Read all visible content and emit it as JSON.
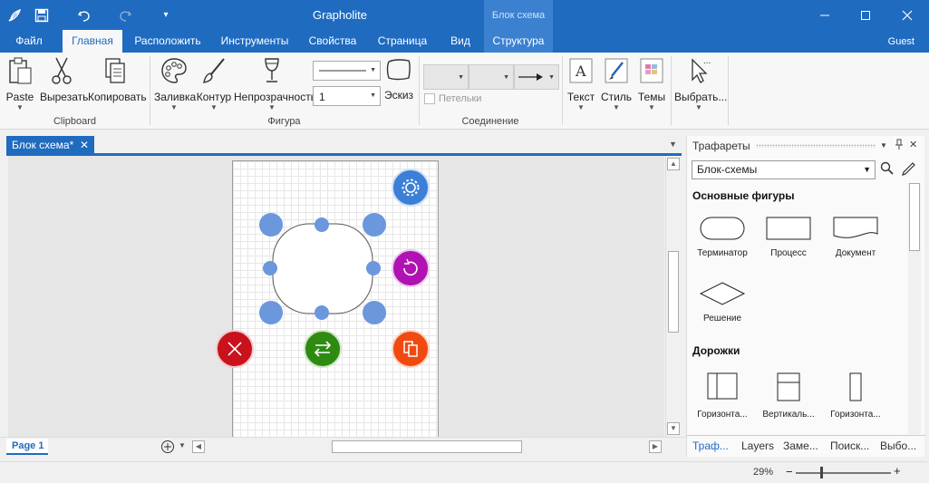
{
  "app": {
    "title": "Grapholite",
    "context_tab_header": "Блок схема",
    "user": "Guest"
  },
  "menu_tabs": [
    {
      "label": "Файл"
    },
    {
      "label": "Главная"
    },
    {
      "label": "Расположить"
    },
    {
      "label": "Инструменты"
    },
    {
      "label": "Свойства"
    },
    {
      "label": "Страница"
    },
    {
      "label": "Вид"
    },
    {
      "label": "Структура"
    }
  ],
  "ribbon": {
    "clipboard": {
      "paste": "Paste",
      "cut": "Вырезать",
      "copy": "Копировать",
      "group": "Clipboard"
    },
    "figure": {
      "fill": "Заливка",
      "outline": "Контур",
      "opacity": "Непрозрачность",
      "line_width": "1",
      "sketch": "Эскиз",
      "group": "Фигура"
    },
    "connection": {
      "loops": "Петельки",
      "group": "Соединение"
    },
    "text": "Текст",
    "style": "Стиль",
    "themes": "Темы",
    "select": "Выбрать..."
  },
  "document": {
    "tab_label": "Блок схема*",
    "page_tab": "Page 1"
  },
  "colors": {
    "accent": "#1f6bc0",
    "handle": "#6b97dc",
    "delete": "#c9121b",
    "swap": "#2f8a12",
    "copy": "#f04a10",
    "rotate": "#b012b3",
    "settings": "#3b7fd6"
  },
  "panel": {
    "title": "Трафареты",
    "selected_stencil": "Блок-схемы",
    "sections": [
      {
        "title": "Основные фигуры",
        "items": [
          "Терминатор",
          "Процесс",
          "Документ",
          "Решение"
        ]
      },
      {
        "title": "Дорожки",
        "items": [
          "Горизонта...",
          "Вертикаль...",
          "Горизонта..."
        ]
      }
    ],
    "tabs": [
      "Траф...",
      "Layers",
      "Заме...",
      "Поиск...",
      "Выбо..."
    ]
  },
  "status": {
    "zoom": "29%"
  }
}
